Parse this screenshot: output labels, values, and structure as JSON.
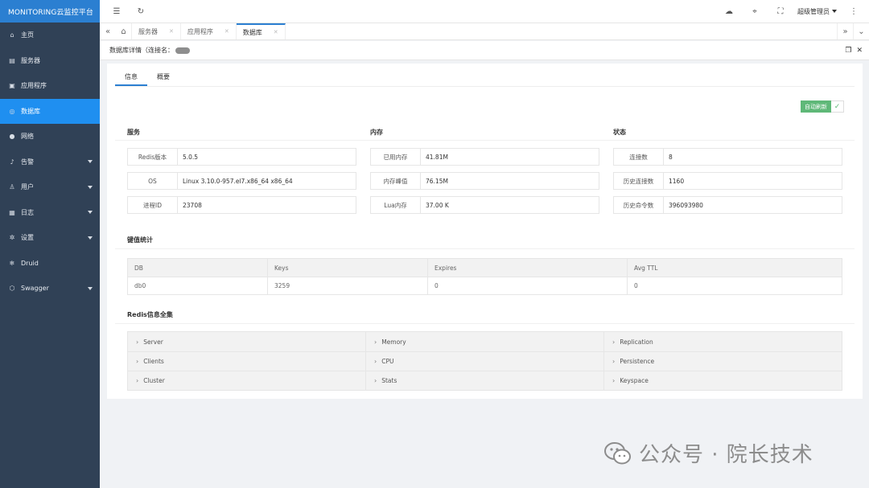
{
  "app": {
    "brand": "MONITORING云监控平台"
  },
  "sidebar": {
    "items": [
      {
        "label": "主页",
        "icon": "home-icon"
      },
      {
        "label": "服务器",
        "icon": "server-icon"
      },
      {
        "label": "应用程序",
        "icon": "app-icon"
      },
      {
        "label": "数据库",
        "icon": "database-icon",
        "active": true
      },
      {
        "label": "网络",
        "icon": "globe-icon"
      },
      {
        "label": "告警",
        "icon": "bell-icon",
        "expandable": true
      },
      {
        "label": "用户",
        "icon": "user-icon",
        "expandable": true
      },
      {
        "label": "日志",
        "icon": "log-icon",
        "expandable": true
      },
      {
        "label": "设置",
        "icon": "gear-icon",
        "expandable": true
      },
      {
        "label": "Druid",
        "icon": "druid-icon"
      },
      {
        "label": "Swagger",
        "icon": "swagger-icon",
        "expandable": true
      }
    ]
  },
  "header": {
    "user": "超级管理员"
  },
  "tabs": [
    {
      "label": "服务器"
    },
    {
      "label": "应用程序"
    },
    {
      "label": "数据库",
      "active": true
    }
  ],
  "page": {
    "title": "数据库详情（连接名："
  },
  "subtabs": [
    {
      "label": "信息",
      "active": true
    },
    {
      "label": "概要"
    }
  ],
  "refresh": {
    "label": "自动刷新"
  },
  "sections": {
    "service": {
      "title": "服务",
      "rows": [
        {
          "key": "Redis版本",
          "value": "5.0.5"
        },
        {
          "key": "OS",
          "value": "Linux 3.10.0-957.el7.x86_64 x86_64"
        },
        {
          "key": "进程ID",
          "value": "23708"
        }
      ]
    },
    "memory": {
      "title": "内存",
      "rows": [
        {
          "key": "已用内存",
          "value": "41.81M"
        },
        {
          "key": "内存峰值",
          "value": "76.15M"
        },
        {
          "key": "Lua内存",
          "value": "37.00 K"
        }
      ]
    },
    "status": {
      "title": "状态",
      "rows": [
        {
          "key": "连接数",
          "value": "8"
        },
        {
          "key": "历史连接数",
          "value": "1160"
        },
        {
          "key": "历史命令数",
          "value": "396093980"
        }
      ]
    },
    "keystats": {
      "title": "键值统计",
      "columns": [
        "DB",
        "Keys",
        "Expires",
        "Avg TTL"
      ],
      "rows": [
        [
          "db0",
          "3259",
          "0",
          "0"
        ]
      ]
    },
    "redisinfo": {
      "title": "Redis信息全集",
      "items": [
        "Server",
        "Memory",
        "Replication",
        "Clients",
        "CPU",
        "Persistence",
        "Cluster",
        "Stats",
        "Keyspace"
      ]
    }
  },
  "watermark": {
    "text": "公众号 · 院长技术"
  }
}
